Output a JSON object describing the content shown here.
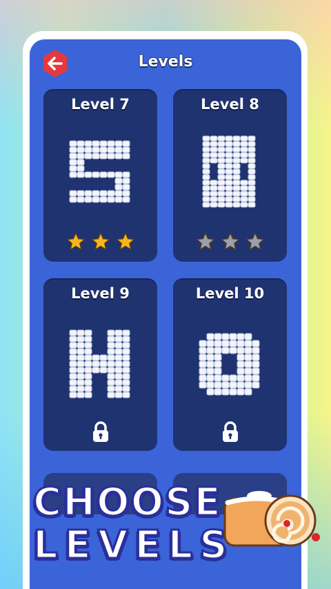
{
  "header": {
    "title": "Levels",
    "back_icon": "arrow-left-icon",
    "back_color": "#e6393d"
  },
  "levels": [
    {
      "label": "Level 7",
      "status": "completed",
      "stars_earned": 3,
      "stars_total": 3,
      "shape": "S"
    },
    {
      "label": "Level 8",
      "status": "unlocked",
      "stars_earned": 0,
      "stars_total": 3,
      "shape": "face"
    },
    {
      "label": "Level 9",
      "status": "locked",
      "shape": "H"
    },
    {
      "label": "Level 10",
      "status": "locked",
      "shape": "ring"
    }
  ],
  "promo": {
    "line1": "CHOOSE",
    "line2": "LEVELS"
  },
  "colors": {
    "screen_bg": "#3a64d8",
    "card_bg": "#1f3370",
    "star_gold": "#f5b51f",
    "star_gray": "#9aa0ad",
    "promo_outline": "#2a2f9a"
  },
  "decor": {
    "image": "swiss-roll-cake-icon"
  }
}
